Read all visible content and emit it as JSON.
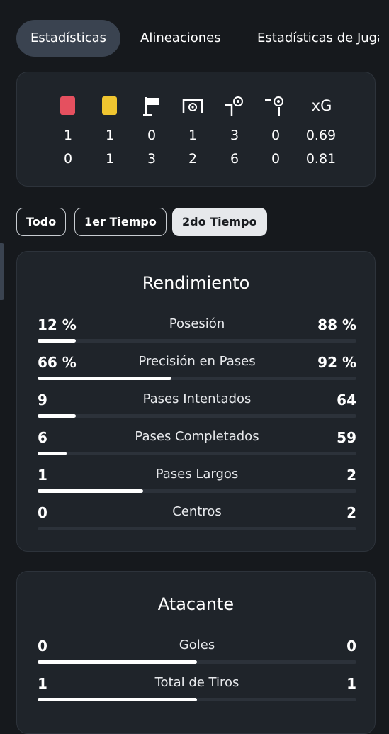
{
  "tabs": [
    "Estadísticas",
    "Alineaciones",
    "Estadísticas de Jugadores"
  ],
  "summary": {
    "icons": [
      "red-card-icon",
      "yellow-card-icon",
      "corner-flag-icon",
      "goal-net-icon",
      "offside-ball-icon",
      "penalty-ball-icon"
    ],
    "xg_label": "xG",
    "home": [
      "1",
      "1",
      "0",
      "1",
      "3",
      "0",
      "0.69"
    ],
    "away": [
      "0",
      "1",
      "3",
      "2",
      "6",
      "0",
      "0.81"
    ]
  },
  "filters": [
    "Todo",
    "1er Tiempo",
    "2do Tiempo"
  ],
  "selected_filter": "2do Tiempo",
  "rendimiento": {
    "title": "Rendimiento",
    "rows": [
      {
        "label": "Posesión",
        "left": "12 %",
        "right": "88 %",
        "share": 0.12
      },
      {
        "label": "Precisión en Pases",
        "left": "66 %",
        "right": "92 %",
        "share": 0.42
      },
      {
        "label": "Pases Intentados",
        "left": "9",
        "right": "64",
        "share": 0.12
      },
      {
        "label": "Pases Completados",
        "left": "6",
        "right": "59",
        "share": 0.09
      },
      {
        "label": "Pases Largos",
        "left": "1",
        "right": "2",
        "share": 0.33
      },
      {
        "label": "Centros",
        "left": "0",
        "right": "2",
        "share": 0.0
      }
    ]
  },
  "atacante": {
    "title": "Atacante",
    "rows": [
      {
        "label": "Goles",
        "left": "0",
        "right": "0",
        "share": 0.5
      },
      {
        "label": "Total de Tiros",
        "left": "1",
        "right": "1",
        "share": 0.5
      }
    ]
  },
  "colors": {
    "background": "#16191d",
    "card": "#1f242a",
    "red_card": "#e5505f",
    "yellow_card": "#efc530"
  }
}
